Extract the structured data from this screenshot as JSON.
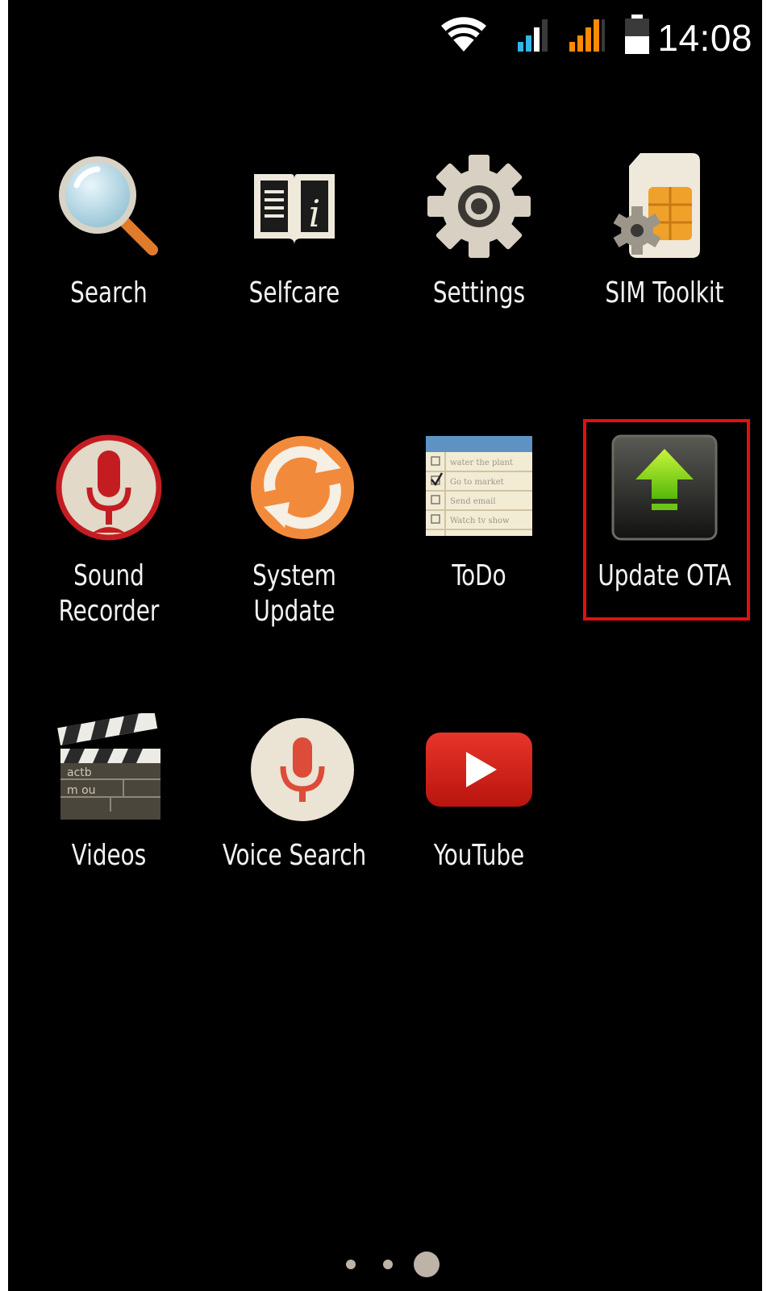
{
  "status_bar": {
    "time": "14:08",
    "icons": [
      "wifi-icon",
      "signal-sim1-icon",
      "signal-sim2-icon",
      "battery-icon"
    ],
    "colors": {
      "sim1": "#33b5e5",
      "sim2": "#ff8a00"
    }
  },
  "apps": [
    {
      "label": "Search",
      "icon": "magnifier-icon"
    },
    {
      "label": "Selfcare",
      "icon": "info-book-icon"
    },
    {
      "label": "Settings",
      "icon": "gear-icon"
    },
    {
      "label": "SIM Toolkit",
      "icon": "sim-card-gear-icon"
    },
    {
      "label": "Sound\nRecorder",
      "icon": "microphone-icon"
    },
    {
      "label": "System Update",
      "icon": "refresh-arrows-icon"
    },
    {
      "label": "ToDo",
      "icon": "todo-list-icon",
      "notes": [
        "water the plant",
        "Go to market",
        "Send email",
        "Watch tv show"
      ]
    },
    {
      "label": "Update OTA",
      "icon": "upload-arrow-icon"
    },
    {
      "label": "Videos",
      "icon": "clapperboard-icon",
      "board_text": [
        "actb",
        "m ou"
      ]
    },
    {
      "label": "Voice Search",
      "icon": "voice-mic-icon"
    },
    {
      "label": "YouTube",
      "icon": "play-button-icon"
    }
  ],
  "highlight": {
    "target": "Update OTA",
    "color": "#e01010"
  },
  "page_indicator": {
    "pages": 3,
    "current": 3
  }
}
